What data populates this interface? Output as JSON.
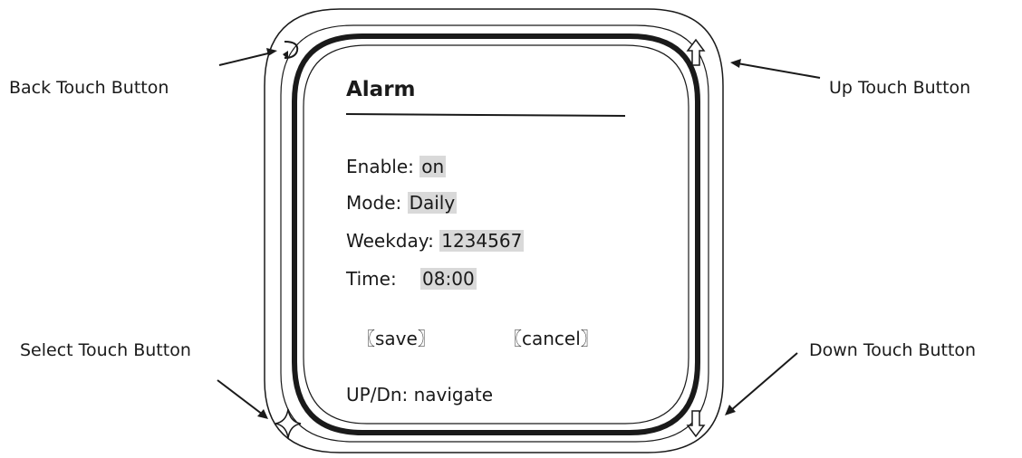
{
  "callouts": {
    "back": "Back Touch Button",
    "up": "Up Touch Button",
    "select": "Select Touch Button",
    "down": "Down Touch Button"
  },
  "screen": {
    "title": "Alarm",
    "rows": [
      {
        "label": "Enable:",
        "value": "on"
      },
      {
        "label": "Mode:",
        "value": "Daily"
      },
      {
        "label": "Weekday:",
        "value": "1234567"
      },
      {
        "label": "Time:",
        "value": "08:00"
      }
    ],
    "save_label": "〖save〗",
    "cancel_label": "〖cancel〗",
    "hint": "UP/Dn: navigate"
  },
  "icons": {
    "back": "back-arrow-icon",
    "up": "up-arrow-icon",
    "down": "down-arrow-icon",
    "select": "four-point-star-icon"
  },
  "colors": {
    "line": "#1a1a1a",
    "highlight": "#d9d9d9"
  }
}
